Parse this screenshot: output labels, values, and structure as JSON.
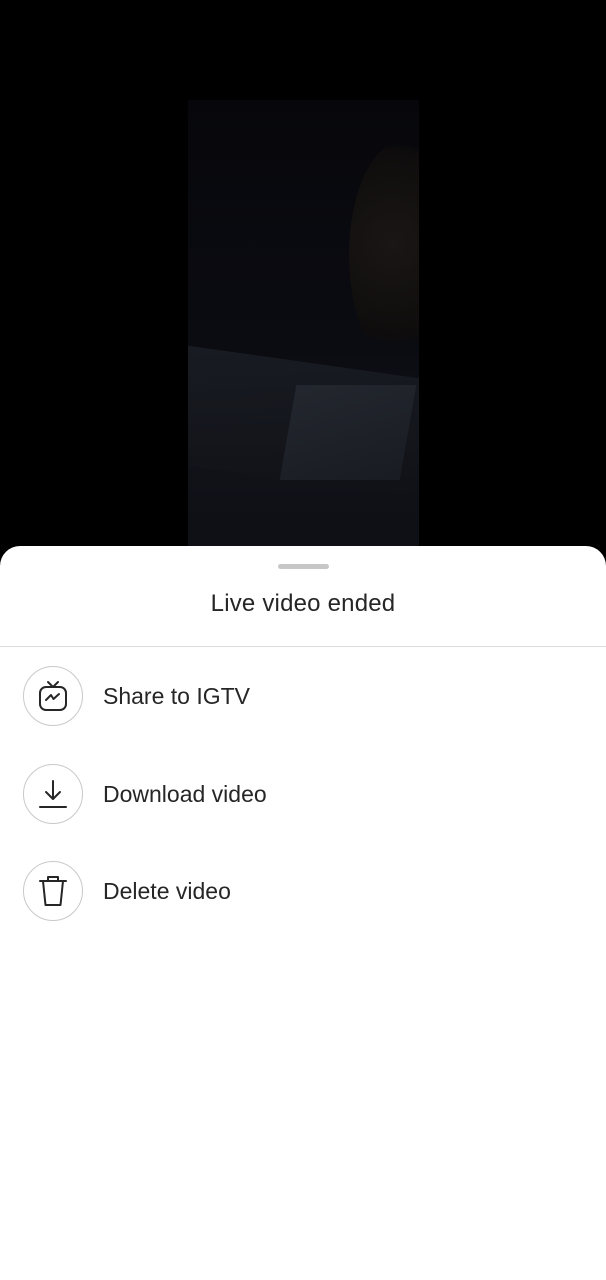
{
  "sheet": {
    "title": "Live video ended",
    "items": [
      {
        "label": "Share to IGTV",
        "icon": "igtv-icon"
      },
      {
        "label": "Download video",
        "icon": "download-icon"
      },
      {
        "label": "Delete video",
        "icon": "trash-icon"
      }
    ]
  },
  "colors": {
    "background": "#000000",
    "sheet_background": "#ffffff",
    "text": "#262626",
    "divider": "#dbdbdb",
    "icon_ring": "#c9c9c9",
    "grabber": "#c7c7c7"
  }
}
